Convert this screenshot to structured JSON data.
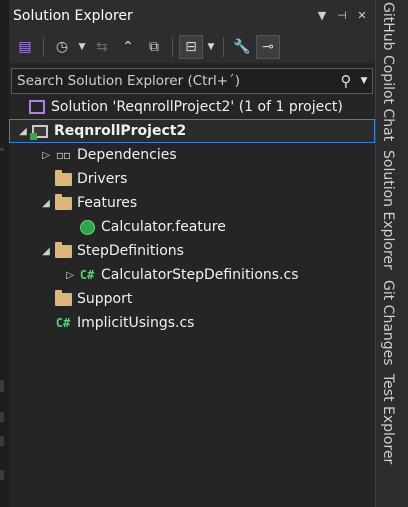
{
  "panel": {
    "title": "Solution Explorer",
    "title_icons": [
      "chevron-down-icon",
      "pin-icon",
      "close-icon"
    ]
  },
  "toolbar": {
    "buttons": [
      "switch-views-icon",
      "history-icon",
      "sync-icon",
      "collapse-all-icon",
      "show-all-files-icon",
      "pending-changes-filter-icon",
      "properties-icon",
      "preview-icon"
    ]
  },
  "search": {
    "placeholder": "Search Solution Explorer (Ctrl+´)"
  },
  "tree": {
    "solution": "Solution 'ReqnrollProject2' (1 of 1 project)",
    "project": "ReqnrollProject2",
    "items": [
      {
        "label": "Dependencies"
      },
      {
        "label": "Drivers"
      },
      {
        "label": "Features"
      },
      {
        "label": "Calculator.feature"
      },
      {
        "label": "StepDefinitions"
      },
      {
        "label": "CalculatorStepDefinitions.cs"
      },
      {
        "label": "Support"
      },
      {
        "label": "ImplicitUsings.cs"
      }
    ]
  },
  "side_tabs": [
    "GitHub Copilot Chat",
    "Solution Explorer",
    "Git Changes",
    "Test Explorer"
  ],
  "colors": {
    "accent_selection": "#3c7fd0",
    "folder": "#dcb67a",
    "csharp": "#57d375",
    "feature": "#2ea44f",
    "solution_icon": "#b181e0"
  }
}
